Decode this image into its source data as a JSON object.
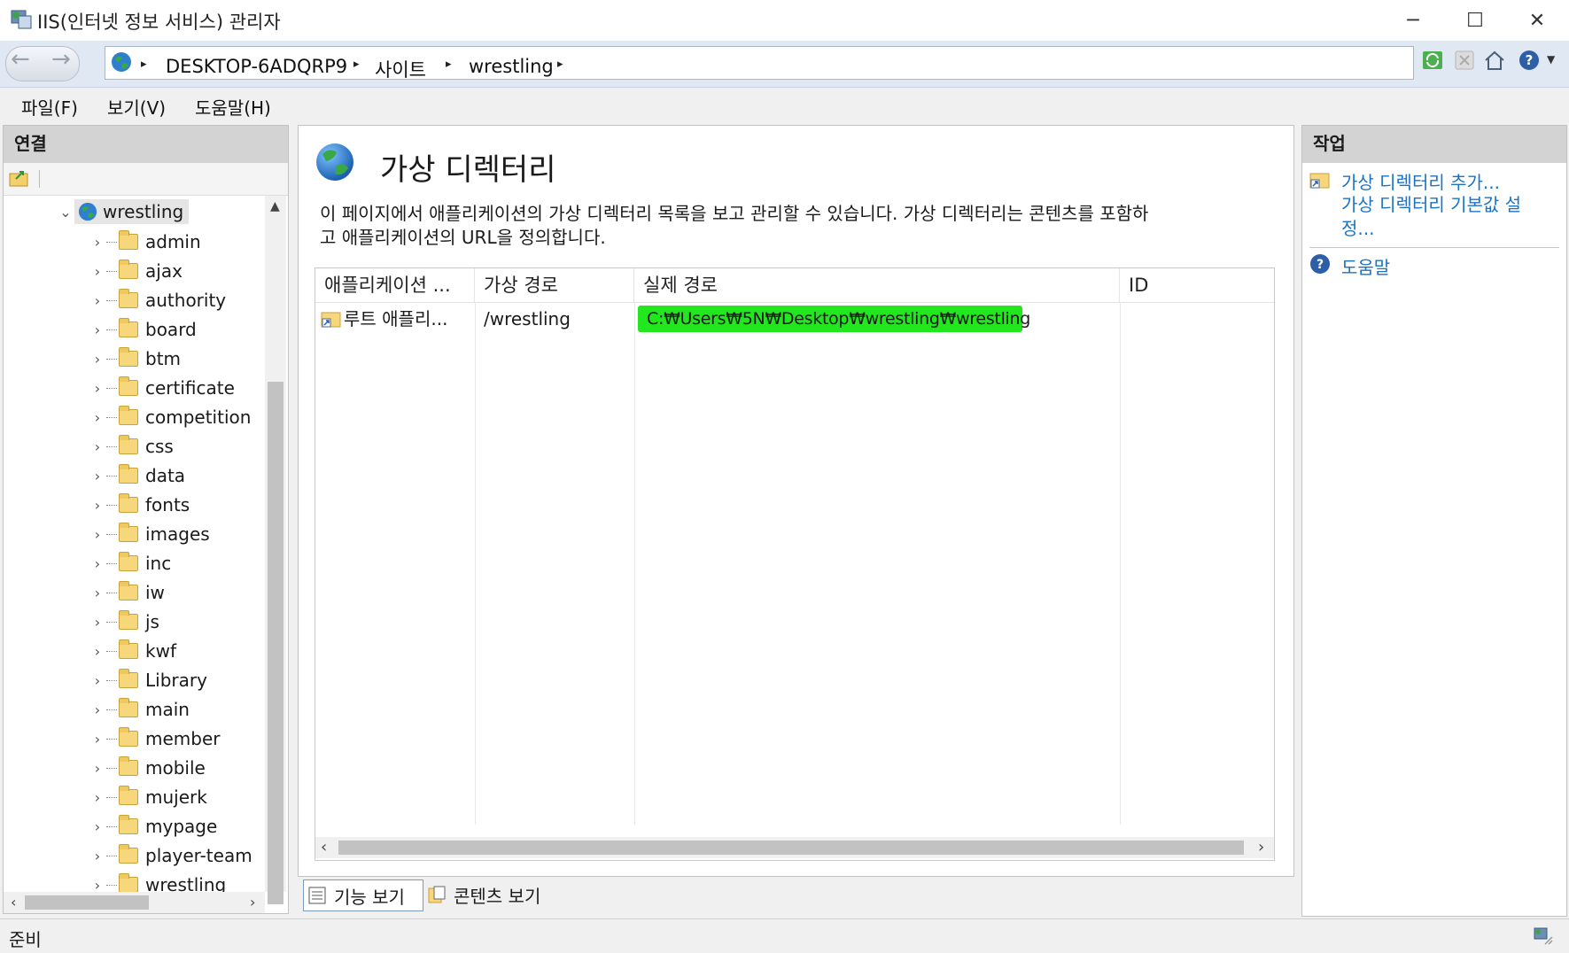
{
  "window": {
    "title": "IIS(인터넷 정보 서비스) 관리자"
  },
  "window_controls": {
    "minimize": "─",
    "maximize": "☐",
    "close": "✕"
  },
  "nav": {
    "back": "←",
    "forward": "→"
  },
  "breadcrumb": {
    "items": [
      "DESKTOP-6ADQRP9",
      "사이트",
      "wrestling"
    ],
    "separator": "▸"
  },
  "menu": {
    "items": [
      "파일(F)",
      "보기(V)",
      "도움말(H)"
    ]
  },
  "connections": {
    "title": "연결",
    "root_node": "wrestling",
    "expander_open": "⌄",
    "expander_closed": "›",
    "children": [
      "admin",
      "ajax",
      "authority",
      "board",
      "btm",
      "certificate",
      "competition",
      "css",
      "data",
      "fonts",
      "images",
      "inc",
      "iw",
      "js",
      "kwf",
      "Library",
      "main",
      "member",
      "mobile",
      "mujerk",
      "mypage",
      "player-team",
      "wrestling"
    ]
  },
  "feature": {
    "title": "가상 디렉터리",
    "description_line1": "이 페이지에서 애플리케이션의 가상 디렉터리 목록을 보고 관리할 수 있습니다. 가상 디렉터리는 콘텐츠를 포함하",
    "description_line2": "고 애플리케이션의 URL을 정의합니다.",
    "columns": [
      "애플리케이션 ...",
      "가상 경로",
      "실제 경로",
      "ID"
    ],
    "rows": [
      {
        "application": "루트 애플리...",
        "virtual_path": "/wrestling",
        "physical_path": "C:₩Users₩5N₩Desktop₩wrestling₩wrestling",
        "identity": ""
      }
    ],
    "highlight_color": "#22e61e"
  },
  "view_tabs": {
    "features": "기능 보기",
    "content": "콘텐츠 보기"
  },
  "actions": {
    "title": "작업",
    "add_virtual_dir": "가상 디렉터리 추가...",
    "set_defaults_line1": "가상 디렉터리 기본값 설",
    "set_defaults_line2": "정...",
    "help": "도움말"
  },
  "status": {
    "text": "준비"
  },
  "colors": {
    "link": "#1a73c6",
    "panel_header": "#d3d3d3",
    "selection": "#e5e5e5"
  }
}
